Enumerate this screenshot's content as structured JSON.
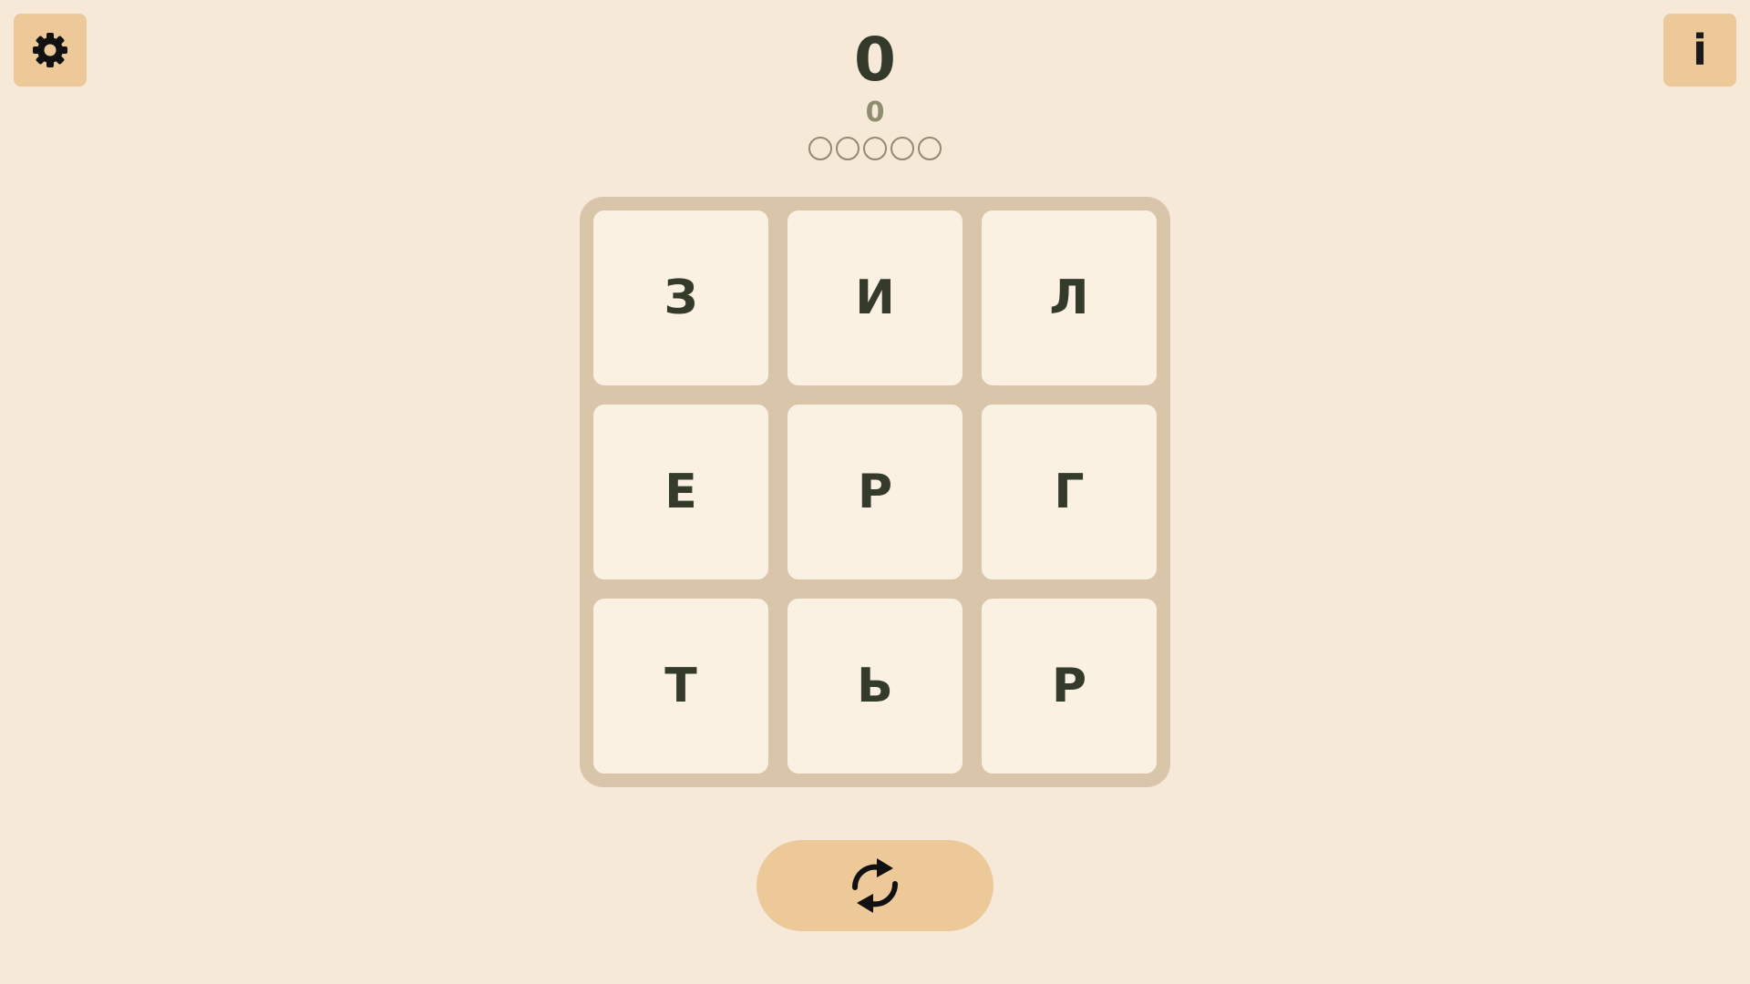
{
  "header": {
    "score": "0",
    "subscore": "0",
    "progress": {
      "total": 5,
      "filled": 0
    }
  },
  "buttons": {
    "settings_icon": "gear-icon",
    "info_label": "i",
    "shuffle_icon": "refresh-icon"
  },
  "board": {
    "tiles": [
      "З",
      "И",
      "Л",
      "Е",
      "Р",
      "Г",
      "Т",
      "Ь",
      "Р"
    ]
  },
  "colors": {
    "background": "#f6e9d7",
    "button": "#edc999",
    "board": "#d8c5aa",
    "tile": "#faf1e2",
    "letter": "#343b2b",
    "muted": "#8f8c70"
  }
}
